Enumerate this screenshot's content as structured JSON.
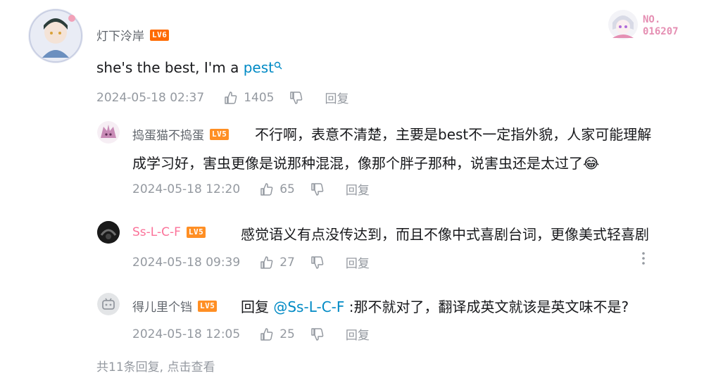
{
  "top_comment": {
    "username": "灯下泠岸",
    "level": "LV6",
    "text": "she's the best, I'm a ",
    "link_text": "pest",
    "date": "2024-05-18 02:37",
    "likes": "1405",
    "reply_label": "回复",
    "badge_no_label": "NO.",
    "badge_no_value": "016207"
  },
  "replies": [
    {
      "username": "捣蛋猫不捣蛋",
      "level": "LV5",
      "text_line1": "不行啊，表意不清楚，主要是best不一定指外貌，人家可能理解",
      "text_line2": "成学习好，害虫更像是说那种混混，像那个胖子那种，说害虫还是太过了",
      "emoji": "😂",
      "date": "2024-05-18 12:20",
      "likes": "65",
      "reply_label": "回复"
    },
    {
      "username": "Ss-L-C-F",
      "level": "LV5",
      "text": "感觉语义有点没传达到，而且不像中式喜剧台词，更像美式轻喜剧",
      "date": "2024-05-18 09:39",
      "likes": "27",
      "reply_label": "回复"
    },
    {
      "username": "得儿里个铛",
      "level": "LV5",
      "text_prefix": "回复 ",
      "mention": "@Ss-L-C-F",
      "text": " :那不就对了，翻译成英文就该是英文味不是?",
      "date": "2024-05-18 12:05",
      "likes": "25",
      "reply_label": "回复"
    }
  ],
  "footer": {
    "more_text": "共11条回复, 点击查看"
  },
  "colors": {
    "username_gray": "#61666d",
    "username_pink": "#fb7299",
    "meta": "#9499a0",
    "link": "#008ac5",
    "level": "#ff6a00"
  }
}
